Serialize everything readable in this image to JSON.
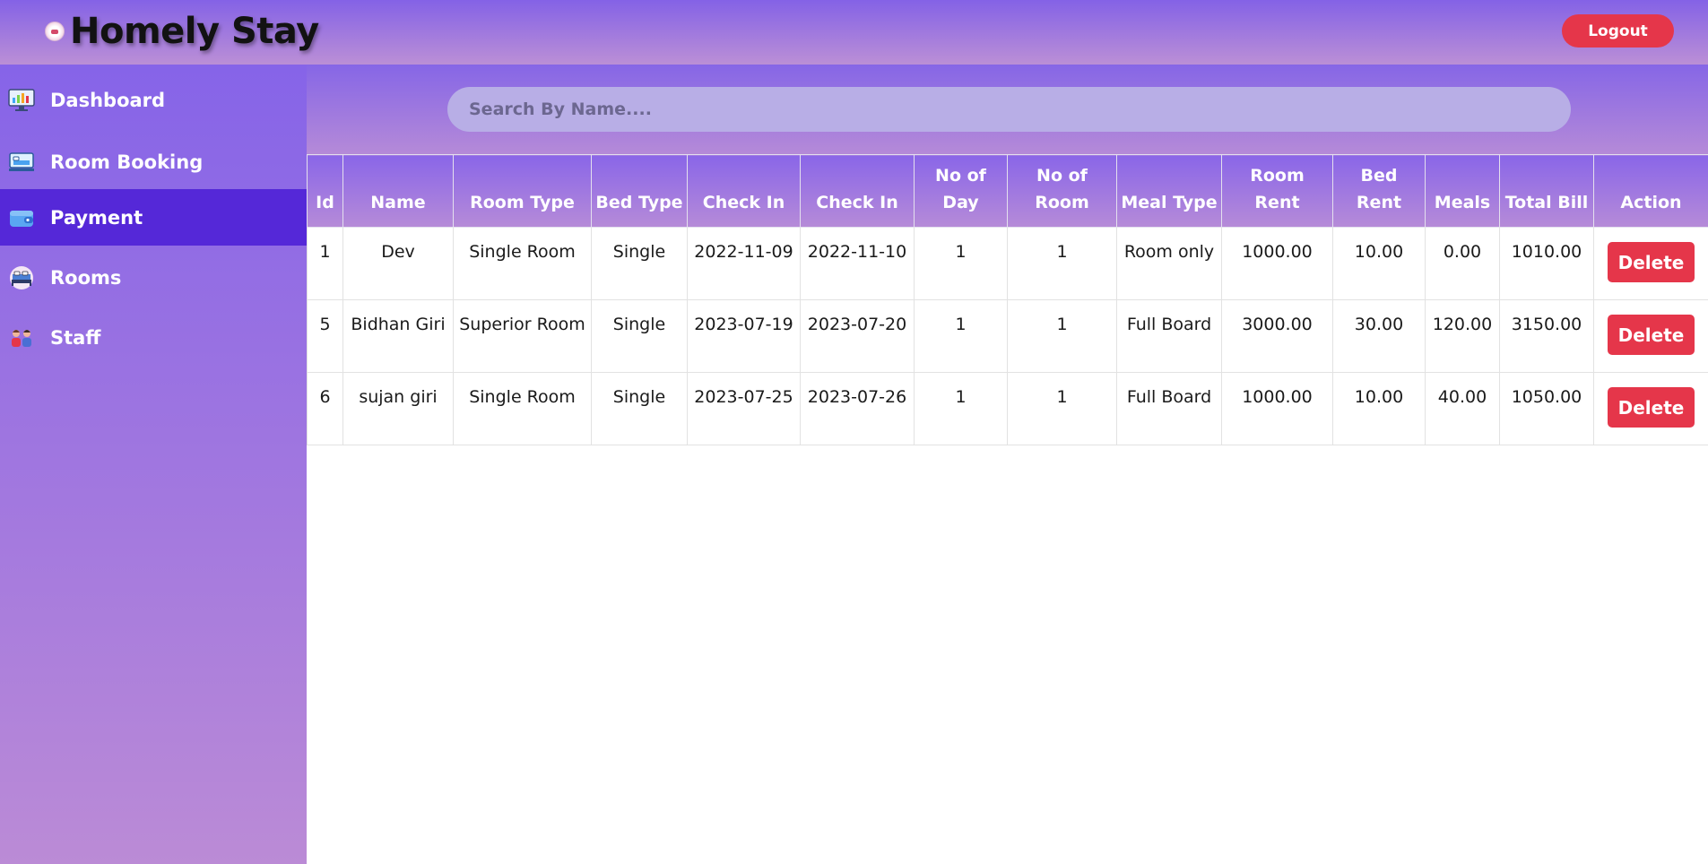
{
  "app": {
    "title": "Homely Stay",
    "logout_label": "Logout"
  },
  "sidebar": {
    "items": [
      {
        "label": "Dashboard",
        "icon": "monitor-chart-icon",
        "active": false
      },
      {
        "label": "Room Booking",
        "icon": "bed-booking-icon",
        "active": false
      },
      {
        "label": "Payment",
        "icon": "wallet-icon",
        "active": true
      },
      {
        "label": "Rooms",
        "icon": "bed-icon",
        "active": false
      },
      {
        "label": "Staff",
        "icon": "staff-people-icon",
        "active": false
      }
    ]
  },
  "search": {
    "placeholder": "Search By Name...."
  },
  "table": {
    "headers": [
      "Id",
      "Name",
      "Room Type",
      "Bed Type",
      "Check In",
      "Check In",
      "No of Day",
      "No of Room",
      "Meal Type",
      "Room Rent",
      "Bed Rent",
      "Meals",
      "Total Bill",
      "Action"
    ],
    "rows": [
      {
        "id": "1",
        "name": "Dev",
        "room_type": "Single Room",
        "bed_type": "Single",
        "check_in": "2022-11-09",
        "check_out": "2022-11-10",
        "no_of_day": "1",
        "no_of_room": "1",
        "meal_type": "Room only",
        "room_rent": "1000.00",
        "bed_rent": "10.00",
        "meals": "0.00",
        "total_bill": "1010.00",
        "action_label": "Delete"
      },
      {
        "id": "5",
        "name": "Bidhan Giri",
        "room_type": "Superior Room",
        "bed_type": "Single",
        "check_in": "2023-07-19",
        "check_out": "2023-07-20",
        "no_of_day": "1",
        "no_of_room": "1",
        "meal_type": "Full Board",
        "room_rent": "3000.00",
        "bed_rent": "30.00",
        "meals": "120.00",
        "total_bill": "3150.00",
        "action_label": "Delete"
      },
      {
        "id": "6",
        "name": "sujan giri",
        "room_type": "Single Room",
        "bed_type": "Single",
        "check_in": "2023-07-25",
        "check_out": "2023-07-26",
        "no_of_day": "1",
        "no_of_room": "1",
        "meal_type": "Full Board",
        "room_rent": "1000.00",
        "bed_rent": "10.00",
        "meals": "40.00",
        "total_bill": "1050.00",
        "action_label": "Delete"
      }
    ]
  },
  "colors": {
    "accent": "#8462e6",
    "active_nav": "#5528d8",
    "danger": "#e5364a"
  }
}
